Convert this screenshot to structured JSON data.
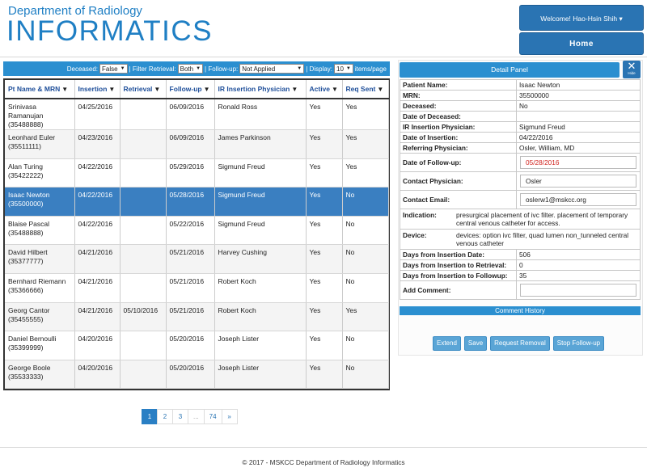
{
  "brand": {
    "top": "Department of Radiology",
    "main": "INFORMATICS"
  },
  "user_menu": {
    "label": "Welcome! Hao-Hsin Shih ▾"
  },
  "nav": {
    "home": "Home"
  },
  "filters": {
    "deceased_label": "Deceased:",
    "deceased_value": "False",
    "retrieval_label": "| Filter Retrieval:",
    "retrieval_value": "Both",
    "followup_label": "| Follow-up:",
    "followup_value": "Not Applied",
    "display_label": "| Display:",
    "display_value": "10",
    "items_label": "items/page"
  },
  "table": {
    "headers": [
      "Pt Name & MRN",
      "Insertion",
      "Retrieval",
      "Follow-up",
      "IR Insertion Physician",
      "Active",
      "Req Sent"
    ],
    "rows": [
      {
        "name": "Srinivasa Ramanujan",
        "mrn": "(35488888)",
        "insertion": "04/25/2016",
        "retrieval": "",
        "followup": "06/09/2016",
        "physician": "Ronald Ross",
        "active": "Yes",
        "req": "Yes"
      },
      {
        "name": "Leonhard Euler",
        "mrn": "(35511111)",
        "insertion": "04/23/2016",
        "retrieval": "",
        "followup": "06/09/2016",
        "physician": "James Parkinson",
        "active": "Yes",
        "req": "Yes"
      },
      {
        "name": "Alan Turing",
        "mrn": "(35422222)",
        "insertion": "04/22/2016",
        "retrieval": "",
        "followup": "05/29/2016",
        "physician": "Sigmund Freud",
        "active": "Yes",
        "req": "Yes"
      },
      {
        "name": "Isaac Newton",
        "mrn": "(35500000)",
        "insertion": "04/22/2016",
        "retrieval": "",
        "followup": "05/28/2016",
        "physician": "Sigmund Freud",
        "active": "Yes",
        "req": "No"
      },
      {
        "name": "Blaise Pascal",
        "mrn": "(35488888)",
        "insertion": "04/22/2016",
        "retrieval": "",
        "followup": "05/22/2016",
        "physician": "Sigmund Freud",
        "active": "Yes",
        "req": "No"
      },
      {
        "name": "David Hilbert",
        "mrn": "(35377777)",
        "insertion": "04/21/2016",
        "retrieval": "",
        "followup": "05/21/2016",
        "physician": "Harvey Cushing",
        "active": "Yes",
        "req": "No"
      },
      {
        "name": "Bernhard Riemann",
        "mrn": "(35366666)",
        "insertion": "04/21/2016",
        "retrieval": "",
        "followup": "05/21/2016",
        "physician": "Robert Koch",
        "active": "Yes",
        "req": "No"
      },
      {
        "name": "Georg Cantor",
        "mrn": "(35455555)",
        "insertion": "04/21/2016",
        "retrieval": "05/10/2016",
        "followup": "05/21/2016",
        "physician": "Robert Koch",
        "active": "Yes",
        "req": "Yes"
      },
      {
        "name": "Daniel Bernoulli",
        "mrn": "(35399999)",
        "insertion": "04/20/2016",
        "retrieval": "",
        "followup": "05/20/2016",
        "physician": "Joseph Lister",
        "active": "Yes",
        "req": "No"
      },
      {
        "name": "George Boole",
        "mrn": "(35533333)",
        "insertion": "04/20/2016",
        "retrieval": "",
        "followup": "05/20/2016",
        "physician": "Joseph Lister",
        "active": "Yes",
        "req": "No"
      }
    ]
  },
  "pagination": [
    "1",
    "2",
    "3",
    "...",
    "74",
    "»"
  ],
  "detail": {
    "title": "Detail Panel",
    "hide_x": "✕",
    "hide_label": "Hide",
    "fields": {
      "patient_name": {
        "k": "Patient Name:",
        "v": "Isaac Newton"
      },
      "mrn": {
        "k": "MRN:",
        "v": "35500000"
      },
      "deceased": {
        "k": "Deceased:",
        "v": "No"
      },
      "date_deceased": {
        "k": "Date of Deceased:",
        "v": ""
      },
      "ir_physician": {
        "k": "IR Insertion Physician:",
        "v": "Sigmund Freud"
      },
      "date_insertion": {
        "k": "Date of Insertion:",
        "v": "04/22/2016"
      },
      "referring": {
        "k": "Referring Physician:",
        "v": "Osler, William, MD"
      },
      "date_followup": {
        "k": "Date of Follow-up:",
        "v": "05/28/2016"
      },
      "contact_physician": {
        "k": "Contact Physician:",
        "v": "Osler"
      },
      "contact_email": {
        "k": "Contact Email:",
        "v": "oslerw1@mskcc.org"
      },
      "indication": {
        "k": "Indication:",
        "v": "presurgical placement of ivc filter. placement of temporary central venous catheter for access."
      },
      "device": {
        "k": "Device:",
        "v": "devices: option ivc filter, quad lumen non_tunneled central venous catheter"
      },
      "days_insertion": {
        "k": "Days from Insertion Date:",
        "v": "506"
      },
      "days_retrieval": {
        "k": "Days from Insertion to Retrieval:",
        "v": "0"
      },
      "days_followup": {
        "k": "Days from Insertion to Followup:",
        "v": "35"
      },
      "add_comment": {
        "k": "Add Comment:",
        "v": ""
      }
    },
    "comment_history": "Comment History",
    "buttons": {
      "extend": "Extend",
      "save": "Save",
      "request_removal": "Request Removal",
      "stop_followup": "Stop Follow-up"
    }
  },
  "footer": "© 2017 - MSKCC Department of Radiology Informatics",
  "colors": {
    "brand_blue": "#1f7fc4",
    "bar_blue": "#2b8fd0",
    "selected_row": "#3a7fc1",
    "alert_red": "#d0231e"
  }
}
